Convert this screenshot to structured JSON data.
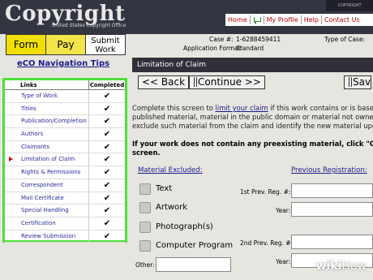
{
  "header": {
    "logo_text": "Copyright",
    "logo_subtitle": "United States Copyright Office",
    "corner_tag": "COPYRIGHT",
    "nav": [
      "Home",
      "My Profile",
      "Help",
      "Contact Us"
    ]
  },
  "case": {
    "case_label": "Case #:",
    "case_value": "1-6288459411",
    "type_label": "Type of Case:",
    "format_label": "Application Format:",
    "format_value": "Standard"
  },
  "steps": {
    "form": "Form",
    "pay": "Pay",
    "submit": "Submit Work"
  },
  "nav_tips": "eCO Navigation Tips",
  "links_panel": {
    "col_links": "Links",
    "col_completed": "Completed",
    "items": [
      {
        "label": "Type of Work",
        "done": "✔"
      },
      {
        "label": "Titles",
        "done": "✔"
      },
      {
        "label": "Publication/Completion",
        "done": "✔"
      },
      {
        "label": "Authors",
        "done": "✔"
      },
      {
        "label": "Claimants",
        "done": "✔"
      },
      {
        "label": "Limitation of Claim",
        "done": "✔"
      },
      {
        "label": "Rights & Permissions",
        "done": "✔"
      },
      {
        "label": "Correspondent",
        "done": "✔"
      },
      {
        "label": "Mail Certificate",
        "done": "✔"
      },
      {
        "label": "Special Handling",
        "done": "✔"
      },
      {
        "label": "Certification",
        "done": "✔"
      },
      {
        "label": "Review Submission",
        "done": "✔"
      }
    ]
  },
  "main": {
    "section_title": "Limitation of Claim",
    "back_label": "<< Back",
    "continue_label": "Continue >>",
    "save_label": "Sav",
    "intro_1a": "Complete this screen to ",
    "intro_link": "limit your claim",
    "intro_1b": " if this work contains or is based",
    "intro_2": "published material, material in the public domain or material not owned",
    "intro_3": "exclude such material from the claim and identify the new material upo",
    "warn_1": "If your work does not contain any preexisting material, click \"Cont",
    "warn_2": "screen.",
    "material_excluded": "Material Excluded",
    "previous_registration": "Previous Registration",
    "colon": ":",
    "checkboxes": [
      "Text",
      "Artwork",
      "Photograph(s)",
      "Computer Program"
    ],
    "other_label": "Other:",
    "reg1_label": "1st Prev. Reg. #:",
    "reg2_label": "2nd Prev. Reg. #:",
    "year_label": "Year:"
  },
  "watermark": {
    "wiki": "wiki",
    "how": "How"
  }
}
